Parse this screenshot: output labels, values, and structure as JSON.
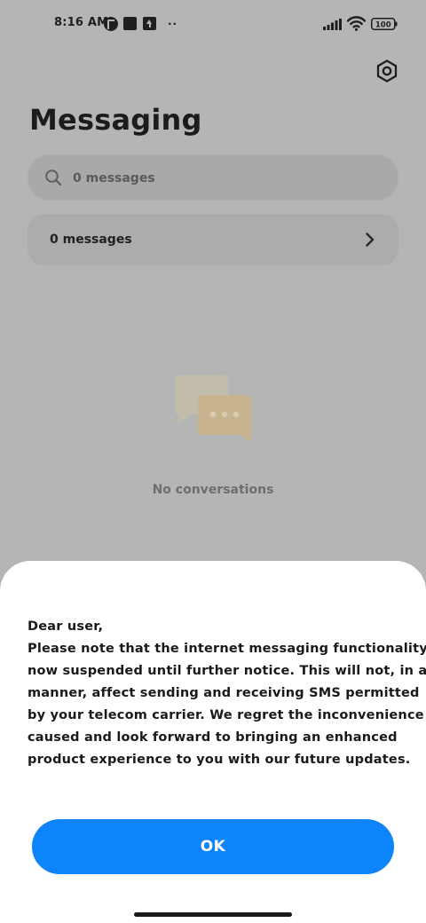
{
  "status_bar": {
    "time": "8:16 AM",
    "more": "··",
    "battery_level": "100",
    "icons": [
      "pocket-icon",
      "square-notification-icon",
      "upload-icon",
      "signal-icon",
      "wifi-icon",
      "battery-icon"
    ]
  },
  "header": {
    "title": "Messaging",
    "settings_icon": "gear-hexagon-icon"
  },
  "search": {
    "placeholder": "0 messages",
    "icon": "search-icon"
  },
  "messages_row": {
    "label": "0 messages",
    "icon": "chevron-right-icon"
  },
  "empty_state": {
    "icon": "chat-bubbles-icon",
    "text": "No conversations"
  },
  "dialog": {
    "lines": [
      "Dear user,",
      "Please note that the internet messaging functionality is",
      "now suspended until further notice. This will not, in any",
      "manner, affect sending and receiving SMS permitted",
      "by your telecom carrier. We regret the inconvenience",
      "caused and look forward to bringing an enhanced",
      "product experience to you with our future updates."
    ],
    "ok_label": "OK"
  },
  "colors": {
    "dim_background": "#b5b5b5",
    "accent": "#0d84fa",
    "sheet": "#ffffff"
  }
}
